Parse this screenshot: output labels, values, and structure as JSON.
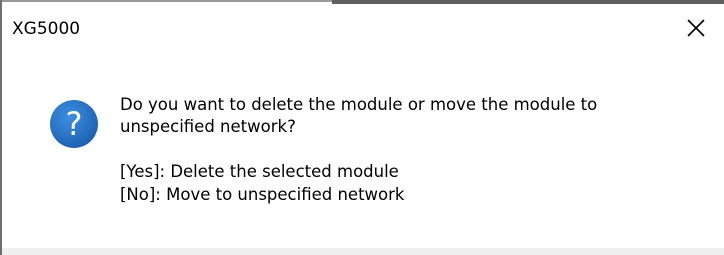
{
  "window": {
    "title": "XG5000"
  },
  "dialog": {
    "icon": "question-icon",
    "message_line1": "Do you want to delete the module or move the module to",
    "message_line2": "unspecified network?",
    "option_yes": "[Yes]: Delete the selected module",
    "option_no": "[No]: Move to unspecified network"
  },
  "colors": {
    "icon_blue": "#1c6fc4",
    "background": "#ffffff"
  }
}
